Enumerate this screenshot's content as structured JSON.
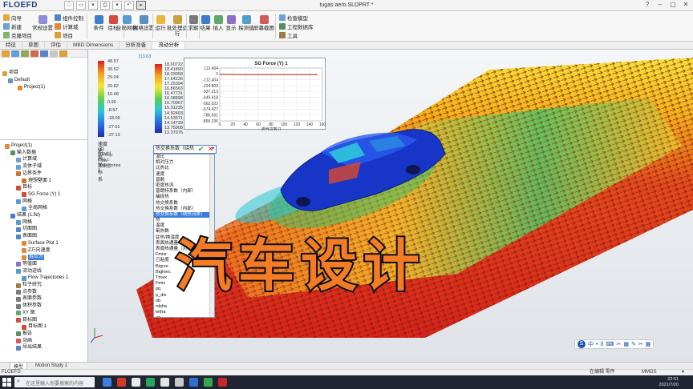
{
  "app": {
    "logo": "FLOEFD",
    "document_title": "tugas aero.SLDPRT *",
    "quick_access": [
      "□",
      "▭",
      "▾",
      "⎙",
      "▾",
      "↶",
      "▸"
    ],
    "window_controls": [
      "?",
      "–",
      "▢",
      "✕"
    ]
  },
  "ribbon": {
    "wizard": "向导",
    "new": "新建",
    "clone_project": "克隆项目",
    "general_settings": "常规设置",
    "component_control": "组件控制",
    "computational_domain": "计算域",
    "project": "项目",
    "condition": "条件",
    "goals": "目标",
    "global_mesh": "全局网格",
    "mesh_settings": "网格设置",
    "run": "运行",
    "batch_run": "批处理运行",
    "solve": "求解",
    "results": "结果",
    "insert": "插入",
    "display": "显示",
    "probe": "探测值",
    "screenshot": "屏幕截图",
    "check_model": "检查模型",
    "engineering_database": "工程数据库",
    "tools": "工具"
  },
  "main_tabs": [
    "特征",
    "草图",
    "评估",
    "MBD Dimensions",
    "分析准备",
    "流动分析"
  ],
  "active_main_tab": "流动分析",
  "tree_top": {
    "root": "项目",
    "default": "Default",
    "project": "Project(1)"
  },
  "analysis_tree": [
    "Project(1)",
    "输入数据",
    "计算域",
    "流体子域",
    "边界条件",
    "理想壁面 1",
    "目标",
    "SG Force (Y) 1",
    "网格",
    "全局网格",
    "结果 (1.fld)",
    "网格",
    "切面图",
    "表面图",
    "Surface Plot 1",
    "Z方向速度",
    "剪应力",
    "等值面",
    "流动迹线",
    "Flow Trajectories 1",
    "粒子研究",
    "点参数",
    "表面参数",
    "体积参数",
    "XY 图",
    "目标图",
    "目标图 1",
    "报告",
    "动画",
    "导出结果"
  ],
  "selected_tree_item": "剪应力",
  "legend_velocity": {
    "values": [
      "48.57",
      "39.52",
      "29.04",
      "20.82",
      "10.48",
      "0.96",
      "-8.57",
      "-18.09",
      "-27.61",
      "-37.13"
    ],
    "label": "速度 (Z) [km/h]",
    "sub_label": "全局坐标系",
    "plot_labels": [
      "Surface Plot 1: 基表图",
      "Flow Trajectories 1"
    ]
  },
  "legend_pressure": {
    "header": "[13.63",
    "values": [
      "18.00722",
      "18.41890",
      "18.03058",
      "17.64226",
      "17.25394",
      "16.86563",
      "16.47731",
      "16.08898",
      "15.70067",
      "15.31235",
      "14.92403",
      "14.53571",
      "14.14739",
      "13.75908",
      "13.37076"
    ]
  },
  "xy_plot": {
    "title": "SG Force (Y) 1",
    "xlabel": "迭代次数 []",
    "ytick_labels": [
      "112.404",
      "0",
      "-112.404",
      "-224.809",
      "-337.213",
      "-449.618",
      "-562.022",
      "-674.427",
      "-786.831",
      "-899.236"
    ],
    "xtick_labels": [
      "0",
      "20",
      "40",
      "60",
      "80",
      "100",
      "120",
      "140",
      "160"
    ]
  },
  "chart_data": {
    "type": "line",
    "title": "SG Force (Y) 1",
    "xlabel": "迭代次数 []",
    "ylabel": "",
    "xlim": [
      0,
      160
    ],
    "ylim": [
      -899.236,
      112.404
    ],
    "grid": true,
    "series": [
      {
        "values": [
          {
            "x": 0,
            "y": 0
          },
          {
            "x": 2,
            "y": -20
          },
          {
            "x": 5,
            "y": -5
          },
          {
            "x": 10,
            "y": -10
          },
          {
            "x": 20,
            "y": -12
          },
          {
            "x": 40,
            "y": -14
          },
          {
            "x": 60,
            "y": -13
          },
          {
            "x": 80,
            "y": -13
          },
          {
            "x": 100,
            "y": -13
          },
          {
            "x": 120,
            "y": -13
          },
          {
            "x": 140,
            "y": -13
          },
          {
            "x": 152,
            "y": -13
          }
        ]
      }
    ]
  },
  "dropdown": {
    "value": "热交换系数（绕热",
    "options": [
      "湿比",
      "相对压力",
      "比热比",
      "速度",
      "普数",
      "密度热流",
      "普朗特系数（内部）",
      "捕捉热",
      "热交换系数",
      "热交换系数（内部）",
      "热交换系数（绕热流体）",
      "热",
      "温度",
      "氧热数",
      "驻热/换温度",
      "表面热通量",
      "表面热通量（对流）",
      "Fmixr",
      "已粘度",
      "Bigcre",
      "Bigherc",
      "Tmax",
      "Fmix",
      "pq",
      "p_dis",
      "nb",
      "rdelta",
      "tetha",
      "ue",
      "空速"
    ],
    "selected": "热交换系数（绕热流体）",
    "ok": "✔",
    "cancel": "✕"
  },
  "overlay_title": "汽车设计",
  "hud": [
    "中",
    "•",
    "ð",
    "⌨",
    "✂",
    "▦",
    "✎",
    "✂",
    "▦"
  ],
  "bottom_tabs": [
    "模型",
    "Motion Study 1"
  ],
  "active_bottom_tab": "模型",
  "status": {
    "left": "FLOEFD",
    "mid": "在编辑 零件",
    "units": "MMGS",
    "arrow": "▾"
  },
  "taskbar": {
    "search_placeholder": "在这里输入你要搜索的内容",
    "time": "22:51",
    "date": "2021/7/20"
  },
  "colors": {
    "accent": "#1f3f7a",
    "title_orange": "#f47c25",
    "selection": "#3b7de0",
    "car_blue": "#1736c7"
  }
}
